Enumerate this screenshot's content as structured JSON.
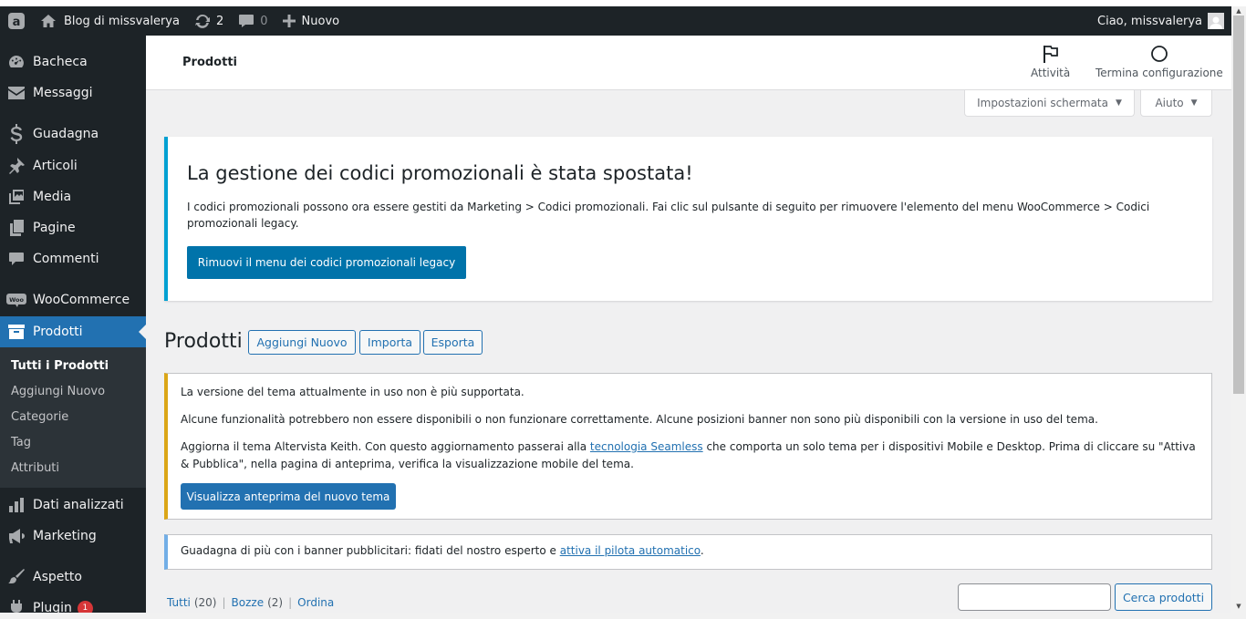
{
  "adminbar": {
    "site_name": "Blog di missvalerya",
    "updates_count": "2",
    "comments_count": "0",
    "new_label": "Nuovo",
    "greeting": "Ciao, missvalerya"
  },
  "sidebar": {
    "items": [
      {
        "label": "Bacheca",
        "icon": "dashboard-icon"
      },
      {
        "label": "Messaggi",
        "icon": "envelope-icon"
      },
      {
        "label": "Guadagna",
        "icon": "dollar-icon"
      },
      {
        "label": "Articoli",
        "icon": "pushpin-icon"
      },
      {
        "label": "Media",
        "icon": "media-icon"
      },
      {
        "label": "Pagine",
        "icon": "pages-icon"
      },
      {
        "label": "Commenti",
        "icon": "comment-icon"
      },
      {
        "label": "WooCommerce",
        "icon": "woocommerce-icon"
      },
      {
        "label": "Prodotti",
        "icon": "archive-icon"
      },
      {
        "label": "Dati analizzati",
        "icon": "bar-chart-icon"
      },
      {
        "label": "Marketing",
        "icon": "megaphone-icon"
      },
      {
        "label": "Aspetto",
        "icon": "paintbrush-icon"
      },
      {
        "label": "Plugin",
        "icon": "plugin-icon",
        "badge": "1"
      }
    ],
    "submenu": [
      "Tutti i Prodotti",
      "Aggiungi Nuovo",
      "Categorie",
      "Tag",
      "Attributi"
    ]
  },
  "wc_header": {
    "title": "Prodotti",
    "activity_label": "Attività",
    "setup_label": "Termina configurazione"
  },
  "screen_options": {
    "screen_label": "Impostazioni schermata",
    "help_label": "Aiuto"
  },
  "promo_notice": {
    "title": "La gestione dei codici promozionali è stata spostata!",
    "text": "I codici promozionali possono ora essere gestiti da Marketing > Codici promozionali. Fai clic sul pulsante di seguito per rimuovere l'elemento del menu WooCommerce > Codici promozionali legacy.",
    "button": "Rimuovi il menu dei codici promozionali legacy"
  },
  "page": {
    "heading": "Prodotti",
    "add_new": "Aggiungi Nuovo",
    "import": "Importa",
    "export": "Esporta"
  },
  "theme_notice": {
    "p1": "La versione del tema attualmente in uso non è più supportata.",
    "p2": "Alcune funzionalità potrebbero non essere disponibili o non funzionare correttamente. Alcune posizioni banner non sono più disponibili con la versione in uso del tema.",
    "p3_before": "Aggiorna il tema Altervista Keith. Con questo aggiornamento passerai alla ",
    "p3_link": "tecnologia Seamless",
    "p3_after": " che comporta un solo tema per i dispositivi Mobile e Desktop. Prima di cliccare su \"Attiva & Pubblica\", nella pagina di anteprima, verifica la visualizzazione mobile del tema.",
    "button": "Visualizza anteprima del nuovo tema"
  },
  "ads_notice": {
    "text_before": "Guadagna di più con i banner pubblicitari: fidati del nostro esperto e ",
    "link": "attiva il pilota automatico",
    "text_after": "."
  },
  "filters": {
    "all_label": "Tutti",
    "all_count": "(20)",
    "drafts_label": "Bozze",
    "drafts_count": "(2)",
    "sort_label": "Ordina"
  },
  "search": {
    "button": "Cerca prodotti",
    "value": ""
  }
}
